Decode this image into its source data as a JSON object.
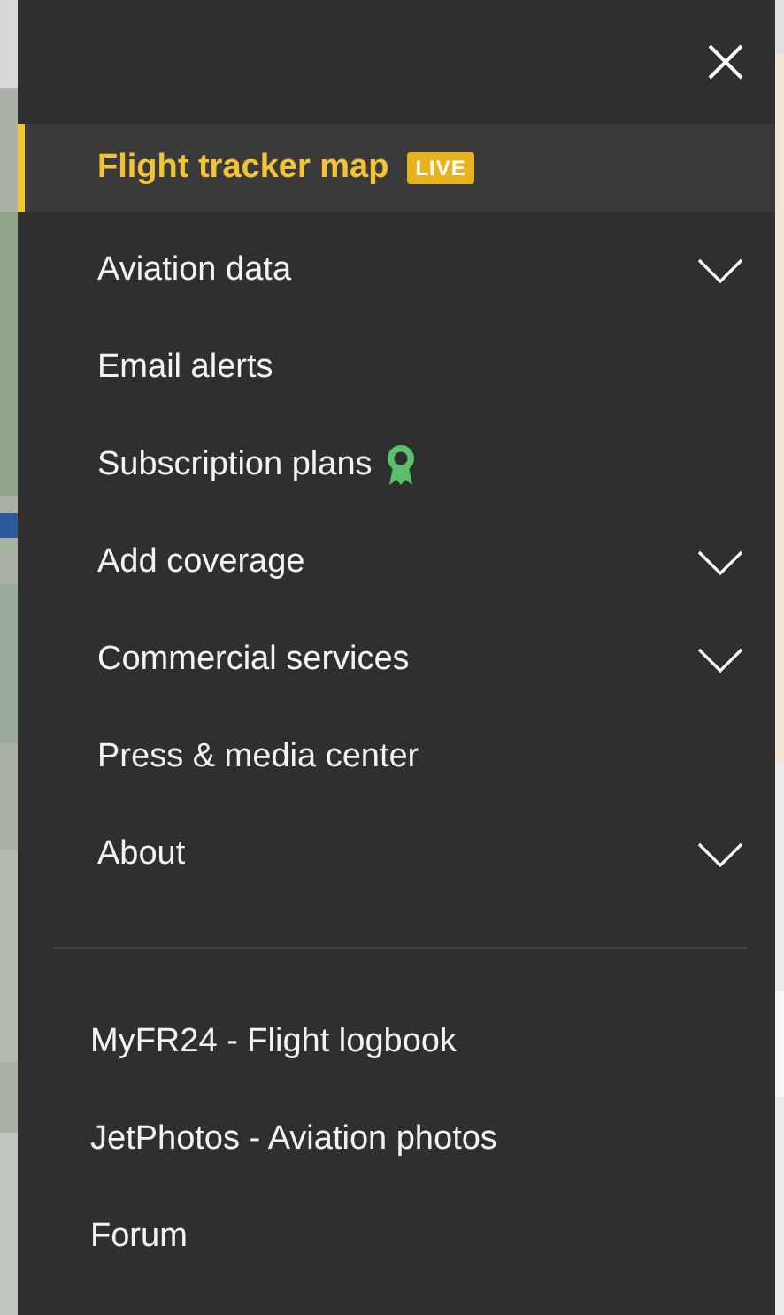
{
  "menu": {
    "items": [
      {
        "label": "Flight tracker map",
        "selected": true,
        "kind": "badge",
        "badge": "LIVE"
      },
      {
        "label": "Aviation data",
        "selected": false,
        "kind": "dropdown"
      },
      {
        "label": "Email alerts",
        "selected": false,
        "kind": "link"
      },
      {
        "label": "Subscription plans",
        "selected": false,
        "kind": "award"
      },
      {
        "label": "Add coverage",
        "selected": false,
        "kind": "dropdown"
      },
      {
        "label": "Commercial services",
        "selected": false,
        "kind": "dropdown"
      },
      {
        "label": "Press & media center",
        "selected": false,
        "kind": "link"
      },
      {
        "label": "About",
        "selected": false,
        "kind": "dropdown"
      }
    ],
    "external_links": [
      {
        "label": "MyFR24 - Flight logbook"
      },
      {
        "label": "JetPhotos - Aviation photos"
      },
      {
        "label": "Forum"
      }
    ]
  }
}
